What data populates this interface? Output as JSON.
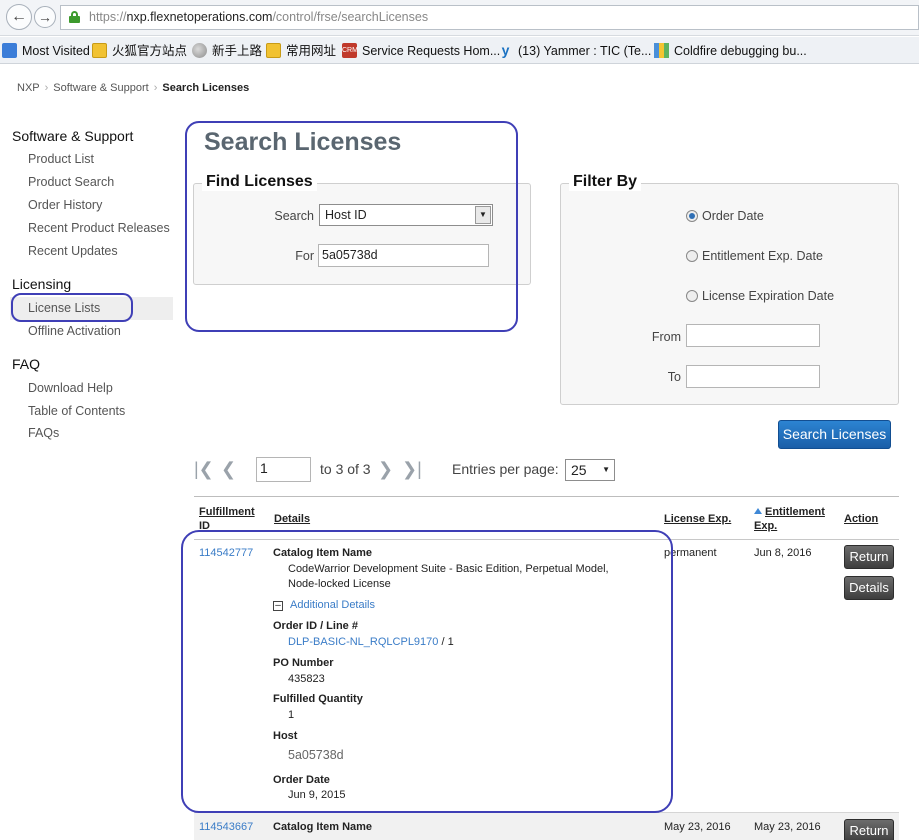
{
  "browser": {
    "url_scheme": "https://",
    "url_host": "nxp.flexnetoperations.com",
    "url_path": "/control/frse/searchLicenses",
    "bookmarks": [
      {
        "label": "Most Visited",
        "icon": "most-visited-icon"
      },
      {
        "label": "火狐官方站点",
        "icon": "folder-icon"
      },
      {
        "label": "新手上路",
        "icon": "globe-icon"
      },
      {
        "label": "常用网址",
        "icon": "folder-icon"
      },
      {
        "label": "Service Requests Hom...",
        "icon": "service-request-icon"
      },
      {
        "label": "(13) Yammer : TIC (Te...",
        "icon": "yammer-icon"
      },
      {
        "label": "Coldfire debugging bu...",
        "icon": "coldfire-icon"
      }
    ]
  },
  "breadcrumb": {
    "items": [
      "NXP",
      "Software & Support"
    ],
    "current": "Search Licenses"
  },
  "sidebar": {
    "section1": "Software & Support",
    "items1": [
      "Product List",
      "Product Search",
      "Order History",
      "Recent Product Releases",
      "Recent Updates"
    ],
    "section2": "Licensing",
    "items2": [
      "License Lists",
      "Offline Activation"
    ],
    "section3": "FAQ",
    "items3": [
      "Download Help",
      "Table of Contents",
      "FAQs"
    ]
  },
  "page_title": "Search Licenses",
  "find": {
    "legend": "Find Licenses",
    "search_label": "Search",
    "search_value": "Host ID",
    "for_label": "For",
    "for_value": "5a05738d"
  },
  "filter": {
    "legend": "Filter By",
    "options": [
      "Order Date",
      "Entitlement Exp. Date",
      "License Expiration Date"
    ],
    "selected": "Order Date",
    "from_label": "From",
    "to_label": "To"
  },
  "search_button": "Search Licenses",
  "pager": {
    "page": "1",
    "of_text": "to 3 of 3",
    "entries_label": "Entries per page:",
    "entries_value": "25"
  },
  "table": {
    "headers": {
      "fulfillment_1": "Fulfillment",
      "fulfillment_2": "ID",
      "details": "Details",
      "license_exp": "License Exp.",
      "entitlement_1": "Entitlement",
      "entitlement_2": "Exp.",
      "action": "Action"
    },
    "rows": [
      {
        "id": "114542777",
        "catalog_label": "Catalog Item Name",
        "catalog_line1": "CodeWarrior Development Suite - Basic Edition, Perpetual Model,",
        "catalog_line2": "Node-locked License",
        "additional": "Additional Details",
        "order_label": "Order ID / Line #",
        "order_link": "DLP-BASIC-NL_RQLCPL9170",
        "order_line": " / 1",
        "po_label": "PO Number",
        "po_value": "435823",
        "qty_label": "Fulfilled Quantity",
        "qty_value": "1",
        "host_label": "Host",
        "host_value": "5a05738d",
        "date_label": "Order Date",
        "date_value": "Jun 9, 2015",
        "license_exp": "permanent",
        "entitlement_exp": "Jun 8, 2016",
        "return": "Return",
        "details": "Details"
      },
      {
        "id": "114543667",
        "catalog_label": "Catalog Item Name",
        "license_exp": "May 23, 2016",
        "entitlement_exp": "May 23, 2016",
        "return": "Return"
      }
    ]
  }
}
